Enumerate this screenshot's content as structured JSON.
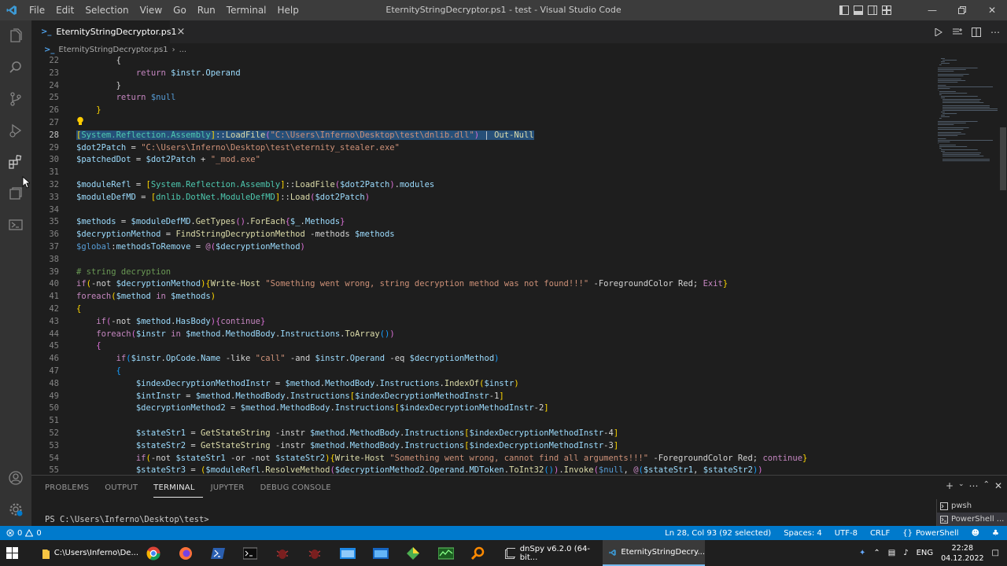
{
  "window": {
    "title": "EternityStringDecryptor.ps1 - test - Visual Studio Code"
  },
  "menu": [
    "File",
    "Edit",
    "Selection",
    "View",
    "Go",
    "Run",
    "Terminal",
    "Help"
  ],
  "tab": {
    "label": "EternityStringDecryptor.ps1",
    "close": "×"
  },
  "breadcrumb": {
    "file": "EternityStringDecryptor.ps1",
    "more": "..."
  },
  "editor": {
    "active_line": 28,
    "lines": [
      {
        "n": "22",
        "t": [
          [
            "o",
            "        {"
          ]
        ]
      },
      {
        "n": "23",
        "t": [
          [
            "o",
            "            "
          ],
          [
            "k",
            "return "
          ],
          [
            "v",
            "$instr"
          ],
          [
            "o",
            "."
          ],
          [
            "v",
            "Operand"
          ]
        ]
      },
      {
        "n": "24",
        "t": [
          [
            "o",
            "        }"
          ]
        ]
      },
      {
        "n": "25",
        "t": [
          [
            "o",
            "        "
          ],
          [
            "k",
            "return "
          ],
          [
            "b",
            "$null"
          ]
        ]
      },
      {
        "n": "26",
        "t": [
          [
            "y",
            "    }"
          ]
        ]
      },
      {
        "n": "27",
        "t": [
          [
            "o",
            ""
          ]
        ]
      },
      {
        "n": "28",
        "sel": true,
        "t": [
          [
            "y",
            "["
          ],
          [
            "t",
            "System.Reflection.Assembly"
          ],
          [
            "y",
            "]"
          ],
          [
            "o",
            "::"
          ],
          [
            "f",
            "LoadFile"
          ],
          [
            "p",
            "("
          ],
          [
            "s",
            "\"C:\\Users\\Inferno\\Desktop\\test\\dnlib.dll\""
          ],
          [
            "p",
            ")"
          ],
          [
            "o",
            " | "
          ],
          [
            "f",
            "Out-Null"
          ]
        ]
      },
      {
        "n": "29",
        "t": [
          [
            "v",
            "$dot2Patch"
          ],
          [
            "o",
            " = "
          ],
          [
            "s",
            "\"C:\\Users\\Inferno\\Desktop\\test\\eternity_stealer.exe\""
          ]
        ]
      },
      {
        "n": "30",
        "t": [
          [
            "v",
            "$patchedDot"
          ],
          [
            "o",
            " = "
          ],
          [
            "v",
            "$dot2Patch"
          ],
          [
            "o",
            " + "
          ],
          [
            "s",
            "\"_mod.exe\""
          ]
        ]
      },
      {
        "n": "31",
        "t": [
          [
            "o",
            ""
          ]
        ]
      },
      {
        "n": "32",
        "t": [
          [
            "v",
            "$moduleRefl"
          ],
          [
            "o",
            " = "
          ],
          [
            "y",
            "["
          ],
          [
            "t",
            "System.Reflection.Assembly"
          ],
          [
            "y",
            "]"
          ],
          [
            "o",
            "::"
          ],
          [
            "f",
            "LoadFile"
          ],
          [
            "p",
            "("
          ],
          [
            "v",
            "$dot2Patch"
          ],
          [
            "p",
            ")"
          ],
          [
            "o",
            "."
          ],
          [
            "v",
            "modules"
          ]
        ]
      },
      {
        "n": "33",
        "t": [
          [
            "v",
            "$moduleDefMD"
          ],
          [
            "o",
            " = "
          ],
          [
            "y",
            "["
          ],
          [
            "t",
            "dnlib.DotNet.ModuleDefMD"
          ],
          [
            "y",
            "]"
          ],
          [
            "o",
            "::"
          ],
          [
            "f",
            "Load"
          ],
          [
            "p",
            "("
          ],
          [
            "v",
            "$dot2Patch"
          ],
          [
            "p",
            ")"
          ]
        ]
      },
      {
        "n": "34",
        "t": [
          [
            "o",
            ""
          ]
        ]
      },
      {
        "n": "35",
        "t": [
          [
            "v",
            "$methods"
          ],
          [
            "o",
            " = "
          ],
          [
            "v",
            "$moduleDefMD"
          ],
          [
            "o",
            "."
          ],
          [
            "f",
            "GetTypes"
          ],
          [
            "p",
            "()"
          ],
          [
            "o",
            "."
          ],
          [
            "f",
            "ForEach"
          ],
          [
            "p",
            "{"
          ],
          [
            "v",
            "$_"
          ],
          [
            "o",
            "."
          ],
          [
            "v",
            "Methods"
          ],
          [
            "p",
            "}"
          ]
        ]
      },
      {
        "n": "36",
        "t": [
          [
            "v",
            "$decryptionMethod"
          ],
          [
            "o",
            " = "
          ],
          [
            "f",
            "FindStringDecryptionMethod"
          ],
          [
            "o",
            " -methods "
          ],
          [
            "v",
            "$methods"
          ]
        ]
      },
      {
        "n": "37",
        "t": [
          [
            "b",
            "$global"
          ],
          [
            "o",
            ":"
          ],
          [
            "v",
            "methodsToRemove"
          ],
          [
            "o",
            " = "
          ],
          [
            "k",
            "@"
          ],
          [
            "p",
            "("
          ],
          [
            "v",
            "$decryptionMethod"
          ],
          [
            "p",
            ")"
          ]
        ]
      },
      {
        "n": "38",
        "t": [
          [
            "o",
            ""
          ]
        ]
      },
      {
        "n": "39",
        "t": [
          [
            "c",
            "# string decryption"
          ]
        ]
      },
      {
        "n": "40",
        "t": [
          [
            "k",
            "if"
          ],
          [
            "y",
            "("
          ],
          [
            "o",
            "-not "
          ],
          [
            "v",
            "$decryptionMethod"
          ],
          [
            "y",
            ")"
          ],
          [
            "y",
            "{"
          ],
          [
            "f",
            "Write-Host"
          ],
          [
            "o",
            " "
          ],
          [
            "s",
            "\"Something went wrong, string decryption method was not found!!!\""
          ],
          [
            "o",
            " -ForegroundColor Red; "
          ],
          [
            "k",
            "Exit"
          ],
          [
            "y",
            "}"
          ]
        ]
      },
      {
        "n": "41",
        "t": [
          [
            "k",
            "foreach"
          ],
          [
            "y",
            "("
          ],
          [
            "v",
            "$method"
          ],
          [
            "o",
            " "
          ],
          [
            "k",
            "in"
          ],
          [
            "o",
            " "
          ],
          [
            "v",
            "$methods"
          ],
          [
            "y",
            ")"
          ]
        ]
      },
      {
        "n": "42",
        "t": [
          [
            "y",
            "{"
          ]
        ]
      },
      {
        "n": "43",
        "t": [
          [
            "o",
            "    "
          ],
          [
            "k",
            "if"
          ],
          [
            "p",
            "("
          ],
          [
            "o",
            "-not "
          ],
          [
            "v",
            "$method"
          ],
          [
            "o",
            "."
          ],
          [
            "v",
            "HasBody"
          ],
          [
            "p",
            ")"
          ],
          [
            "p",
            "{"
          ],
          [
            "k",
            "continue"
          ],
          [
            "p",
            "}"
          ]
        ]
      },
      {
        "n": "44",
        "t": [
          [
            "o",
            "    "
          ],
          [
            "k",
            "foreach"
          ],
          [
            "p",
            "("
          ],
          [
            "v",
            "$instr"
          ],
          [
            "o",
            " "
          ],
          [
            "k",
            "in"
          ],
          [
            "o",
            " "
          ],
          [
            "v",
            "$method"
          ],
          [
            "o",
            "."
          ],
          [
            "v",
            "MethodBody"
          ],
          [
            "o",
            "."
          ],
          [
            "v",
            "Instructions"
          ],
          [
            "o",
            "."
          ],
          [
            "f",
            "ToArray"
          ],
          [
            "q",
            "()"
          ],
          [
            "p",
            ")"
          ]
        ]
      },
      {
        "n": "45",
        "t": [
          [
            "o",
            "    "
          ],
          [
            "p",
            "{"
          ]
        ]
      },
      {
        "n": "46",
        "t": [
          [
            "o",
            "        "
          ],
          [
            "k",
            "if"
          ],
          [
            "q",
            "("
          ],
          [
            "v",
            "$instr"
          ],
          [
            "o",
            "."
          ],
          [
            "v",
            "OpCode"
          ],
          [
            "o",
            "."
          ],
          [
            "v",
            "Name"
          ],
          [
            "o",
            " -like "
          ],
          [
            "s",
            "\"call\""
          ],
          [
            "o",
            " -and "
          ],
          [
            "v",
            "$instr"
          ],
          [
            "o",
            "."
          ],
          [
            "v",
            "Operand"
          ],
          [
            "o",
            " -eq "
          ],
          [
            "v",
            "$decryptionMethod"
          ],
          [
            "q",
            ")"
          ]
        ]
      },
      {
        "n": "47",
        "t": [
          [
            "o",
            "        "
          ],
          [
            "q",
            "{"
          ]
        ]
      },
      {
        "n": "48",
        "t": [
          [
            "o",
            "            "
          ],
          [
            "v",
            "$indexDecryptionMethodInstr"
          ],
          [
            "o",
            " = "
          ],
          [
            "v",
            "$method"
          ],
          [
            "o",
            "."
          ],
          [
            "v",
            "MethodBody"
          ],
          [
            "o",
            "."
          ],
          [
            "v",
            "Instructions"
          ],
          [
            "o",
            "."
          ],
          [
            "f",
            "IndexOf"
          ],
          [
            "y",
            "("
          ],
          [
            "v",
            "$instr"
          ],
          [
            "y",
            ")"
          ]
        ]
      },
      {
        "n": "49",
        "t": [
          [
            "o",
            "            "
          ],
          [
            "v",
            "$intInstr"
          ],
          [
            "o",
            " = "
          ],
          [
            "v",
            "$method"
          ],
          [
            "o",
            "."
          ],
          [
            "v",
            "MethodBody"
          ],
          [
            "o",
            "."
          ],
          [
            "v",
            "Instructions"
          ],
          [
            "y",
            "["
          ],
          [
            "v",
            "$indexDecryptionMethodInstr"
          ],
          [
            "o",
            "-1"
          ],
          [
            "y",
            "]"
          ]
        ]
      },
      {
        "n": "50",
        "t": [
          [
            "o",
            "            "
          ],
          [
            "v",
            "$decryptionMethod2"
          ],
          [
            "o",
            " = "
          ],
          [
            "v",
            "$method"
          ],
          [
            "o",
            "."
          ],
          [
            "v",
            "MethodBody"
          ],
          [
            "o",
            "."
          ],
          [
            "v",
            "Instructions"
          ],
          [
            "y",
            "["
          ],
          [
            "v",
            "$indexDecryptionMethodInstr"
          ],
          [
            "o",
            "-2"
          ],
          [
            "y",
            "]"
          ]
        ]
      },
      {
        "n": "51",
        "t": [
          [
            "o",
            ""
          ]
        ]
      },
      {
        "n": "52",
        "t": [
          [
            "o",
            "            "
          ],
          [
            "v",
            "$stateStr1"
          ],
          [
            "o",
            " = "
          ],
          [
            "f",
            "GetStateString"
          ],
          [
            "o",
            " -instr "
          ],
          [
            "v",
            "$method"
          ],
          [
            "o",
            "."
          ],
          [
            "v",
            "MethodBody"
          ],
          [
            "o",
            "."
          ],
          [
            "v",
            "Instructions"
          ],
          [
            "y",
            "["
          ],
          [
            "v",
            "$indexDecryptionMethodInstr"
          ],
          [
            "o",
            "-4"
          ],
          [
            "y",
            "]"
          ]
        ]
      },
      {
        "n": "53",
        "t": [
          [
            "o",
            "            "
          ],
          [
            "v",
            "$stateStr2"
          ],
          [
            "o",
            " = "
          ],
          [
            "f",
            "GetStateString"
          ],
          [
            "o",
            " -instr "
          ],
          [
            "v",
            "$method"
          ],
          [
            "o",
            "."
          ],
          [
            "v",
            "MethodBody"
          ],
          [
            "o",
            "."
          ],
          [
            "v",
            "Instructions"
          ],
          [
            "y",
            "["
          ],
          [
            "v",
            "$indexDecryptionMethodInstr"
          ],
          [
            "o",
            "-3"
          ],
          [
            "y",
            "]"
          ]
        ]
      },
      {
        "n": "54",
        "t": [
          [
            "o",
            "            "
          ],
          [
            "k",
            "if"
          ],
          [
            "y",
            "("
          ],
          [
            "o",
            "-not "
          ],
          [
            "v",
            "$stateStr1"
          ],
          [
            "o",
            " -or -not "
          ],
          [
            "v",
            "$stateStr2"
          ],
          [
            "y",
            ")"
          ],
          [
            "y",
            "{"
          ],
          [
            "f",
            "Write-Host"
          ],
          [
            "o",
            " "
          ],
          [
            "s",
            "\"Something went wrong, cannot find all arguments!!!\""
          ],
          [
            "o",
            " -ForegroundColor Red; "
          ],
          [
            "k",
            "continue"
          ],
          [
            "y",
            "}"
          ]
        ]
      },
      {
        "n": "55",
        "t": [
          [
            "o",
            "            "
          ],
          [
            "v",
            "$stateStr3"
          ],
          [
            "o",
            " = "
          ],
          [
            "y",
            "("
          ],
          [
            "v",
            "$moduleRefl"
          ],
          [
            "o",
            "."
          ],
          [
            "f",
            "ResolveMethod"
          ],
          [
            "p",
            "("
          ],
          [
            "v",
            "$decryptionMethod2"
          ],
          [
            "o",
            "."
          ],
          [
            "v",
            "Operand"
          ],
          [
            "o",
            "."
          ],
          [
            "v",
            "MDToken"
          ],
          [
            "o",
            "."
          ],
          [
            "f",
            "ToInt32"
          ],
          [
            "q",
            "()"
          ],
          [
            "p",
            ")"
          ],
          [
            "o",
            "."
          ],
          [
            "f",
            "Invoke"
          ],
          [
            "p",
            "("
          ],
          [
            "b",
            "$null"
          ],
          [
            "o",
            ", "
          ],
          [
            "k",
            "@"
          ],
          [
            "q",
            "("
          ],
          [
            "v",
            "$stateStr1"
          ],
          [
            "o",
            ", "
          ],
          [
            "v",
            "$stateStr2"
          ],
          [
            "q",
            ")"
          ],
          [
            "p",
            ")"
          ]
        ]
      }
    ]
  },
  "panel": {
    "tabs": [
      "PROBLEMS",
      "OUTPUT",
      "TERMINAL",
      "JUPYTER",
      "DEBUG CONSOLE"
    ],
    "active_tab": "TERMINAL",
    "prompt": "PS C:\\Users\\Inferno\\Desktop\\test>",
    "terminals": [
      "pwsh",
      "PowerShell ..."
    ]
  },
  "status": {
    "errors": "0",
    "warnings": "0",
    "position": "Ln 28, Col 93 (92 selected)",
    "spaces": "Spaces: 4",
    "encoding": "UTF-8",
    "eol": "CRLF",
    "language": "PowerShell"
  },
  "taskbar": {
    "items": [
      "C:\\Users\\Inferno\\De...",
      "dnSpy v6.2.0 (64-bit...",
      "EternityStringDecry..."
    ],
    "lang": "ENG",
    "time": "22:28",
    "date": "04.12.2022"
  },
  "colors": {
    "accent": "#007acc",
    "selection": "#264f78",
    "editor_bg": "#1e1e1e"
  }
}
